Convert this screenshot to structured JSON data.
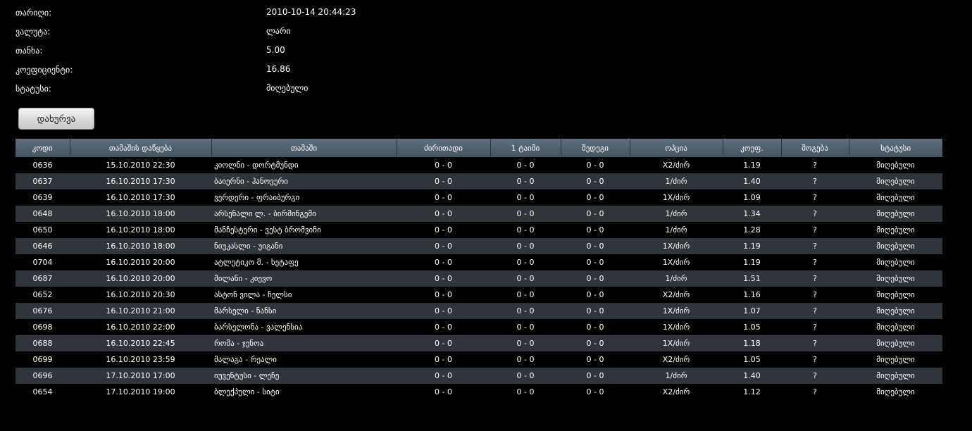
{
  "info": {
    "date_label": "თარიღი:",
    "date_value": "2010-10-14 20:44:23",
    "currency_label": "ვალუტა:",
    "currency_value": "ლარი",
    "amount_label": "თანხა:",
    "amount_value": "5.00",
    "coef_label": "კოეფიციენტი:",
    "coef_value": "16.86",
    "status_label": "სტატუსი:",
    "status_value": "მიღებული"
  },
  "close_button": "დახურვა",
  "table": {
    "headers": [
      "კოდი",
      "თამაშის დაწყება",
      "თამაში",
      "ძირითადი",
      "1 ტაიმი",
      "შედეგი",
      "ოპცია",
      "კოეფ.",
      "მოგება",
      "სტატუსი"
    ],
    "rows": [
      [
        "0636",
        "15.10.2010 22:30",
        "კიოლნი - დორტმუნდი",
        "0 - 0",
        "0 - 0",
        "0 - 0",
        "X2/ძირ",
        "1.19",
        "?",
        "მიღებული"
      ],
      [
        "0637",
        "16.10.2010 17:30",
        "ბაიერნი - ჰანოვერი",
        "0 - 0",
        "0 - 0",
        "0 - 0",
        "1/ძირ",
        "1.40",
        "?",
        "მიღებული"
      ],
      [
        "0639",
        "16.10.2010 17:30",
        "ვერდერი - ფრაიბურგი",
        "0 - 0",
        "0 - 0",
        "0 - 0",
        "1X/ძირ",
        "1.09",
        "?",
        "მიღებული"
      ],
      [
        "0648",
        "16.10.2010 18:00",
        "არსენალი ლ. - ბირმინგემი",
        "0 - 0",
        "0 - 0",
        "0 - 0",
        "1/ძირ",
        "1.34",
        "?",
        "მიღებული"
      ],
      [
        "0650",
        "16.10.2010 18:00",
        "მანჩესტერი - ვესტ ბრომვიჩი",
        "0 - 0",
        "0 - 0",
        "0 - 0",
        "1/ძირ",
        "1.28",
        "?",
        "მიღებული"
      ],
      [
        "0646",
        "16.10.2010 18:00",
        "ნიუკასლი - უიგანი",
        "0 - 0",
        "0 - 0",
        "0 - 0",
        "1X/ძირ",
        "1.19",
        "?",
        "მიღებული"
      ],
      [
        "0704",
        "16.10.2010 20:00",
        "ატლეტიკო მ. - ხეტაფე",
        "0 - 0",
        "0 - 0",
        "0 - 0",
        "1X/ძირ",
        "1.19",
        "?",
        "მიღებული"
      ],
      [
        "0687",
        "16.10.2010 20:00",
        "მილანი - კიევო",
        "0 - 0",
        "0 - 0",
        "0 - 0",
        "1/ძირ",
        "1.51",
        "?",
        "მიღებული"
      ],
      [
        "0652",
        "16.10.2010 20:30",
        "ასტონ ვილა - ჩელსი",
        "0 - 0",
        "0 - 0",
        "0 - 0",
        "X2/ძირ",
        "1.16",
        "?",
        "მიღებული"
      ],
      [
        "0676",
        "16.10.2010 21:00",
        "მარსელი - ნანსი",
        "0 - 0",
        "0 - 0",
        "0 - 0",
        "1X/ძირ",
        "1.07",
        "?",
        "მიღებული"
      ],
      [
        "0698",
        "16.10.2010 22:00",
        "ბარსელონა - ვალენსია",
        "0 - 0",
        "0 - 0",
        "0 - 0",
        "1X/ძირ",
        "1.05",
        "?",
        "მიღებული"
      ],
      [
        "0688",
        "16.10.2010 22:45",
        "რომა - ჯენოა",
        "0 - 0",
        "0 - 0",
        "0 - 0",
        "1X/ძირ",
        "1.18",
        "?",
        "მიღებული"
      ],
      [
        "0699",
        "16.10.2010 23:59",
        "მალაგა - რეალი",
        "0 - 0",
        "0 - 0",
        "0 - 0",
        "X2/ძირ",
        "1.05",
        "?",
        "მიღებული"
      ],
      [
        "0696",
        "17.10.2010 17:00",
        "იუვენტუსი - ლეჩე",
        "0 - 0",
        "0 - 0",
        "0 - 0",
        "1/ძირ",
        "1.40",
        "?",
        "მიღებული"
      ],
      [
        "0654",
        "17.10.2010 19:00",
        "ბლექპული - სიტი",
        "0 - 0",
        "0 - 0",
        "0 - 0",
        "X2/ძირ",
        "1.12",
        "?",
        "მიღებული"
      ]
    ]
  }
}
